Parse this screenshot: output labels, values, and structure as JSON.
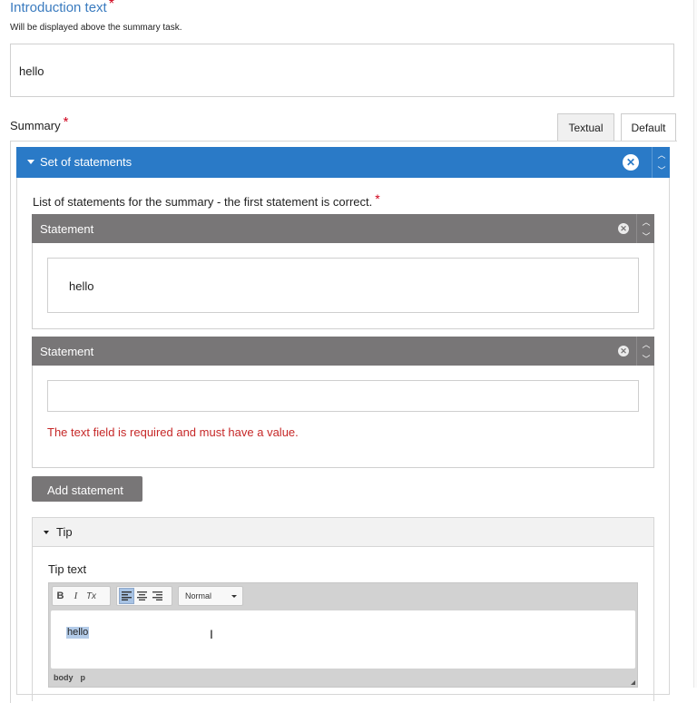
{
  "intro": {
    "label": "Introduction text",
    "required_mark": "*",
    "description": "Will be displayed above the summary task.",
    "value": "hello"
  },
  "summary": {
    "label": "Summary",
    "required_mark": "*",
    "tabs": [
      {
        "label": "Textual",
        "active": false
      },
      {
        "label": "Default",
        "active": true
      }
    ]
  },
  "set_of_statements": {
    "title": "Set of statements",
    "remove_icon": "close-circle-icon",
    "list_label": "List of statements for the summary - the first statement is correct.",
    "required_mark": "*",
    "statements": [
      {
        "title": "Statement",
        "value": "hello",
        "error": ""
      },
      {
        "title": "Statement",
        "value": "",
        "error": "The text field is required and must have a value."
      }
    ],
    "add_label": "Add statement"
  },
  "tip": {
    "title": "Tip",
    "label": "Tip text",
    "toolbar": {
      "buttons": [
        "B",
        "I",
        "Tx"
      ],
      "align": [
        "align-left",
        "align-center",
        "align-right"
      ],
      "format_value": "Normal"
    },
    "content": "hello",
    "path": [
      "body",
      "p"
    ]
  },
  "colors": {
    "accent": "#2a7ac7",
    "statement_header": "#787677",
    "error": "#c62828",
    "required": "#d0021b"
  }
}
